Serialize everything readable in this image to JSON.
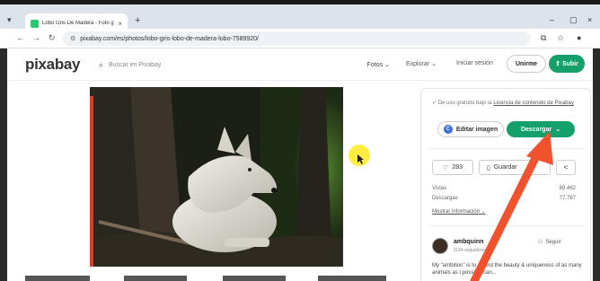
{
  "browser": {
    "tab_title": "Lobo Gris De Madera - Foto gratis",
    "tab_close": "×",
    "new_tab": "+",
    "url": "pixabay.com/es/photos/lobo-gris-lobo-de-madera-lobo-7589920/",
    "window_controls": [
      "–",
      "▢",
      "×"
    ]
  },
  "site": {
    "logo": "pixabay",
    "search_placeholder": "Buscar en Pixabay",
    "search_type": "Fotos",
    "nav": {
      "explore": "Explorar",
      "login": "Iniciar sesión",
      "join": "Unirme",
      "upload": "Subir"
    }
  },
  "sidebar": {
    "license_text": "De uso gratuito bajo la",
    "license_link": "Licencia de contenido de Pixabay",
    "edit_label": "Editar imagen",
    "download_label": "Descargar",
    "likes": "283",
    "save_label": "Guardar",
    "stats": [
      {
        "label": "Vistas",
        "value": "89.462"
      },
      {
        "label": "Descargas",
        "value": "77.787"
      }
    ],
    "more_info": "Mostrar información",
    "author": "ambquinn",
    "followers": "1164 seguidores",
    "follow_label": "Seguir",
    "bio": "My \"ambition\" is to record the beauty & uniqueness of as many animals as I possibly can..."
  },
  "colors": {
    "brand_green": "#14a06b",
    "annotation_arrow": "#f0522e",
    "cursor_highlight": "#ffeb1e"
  }
}
